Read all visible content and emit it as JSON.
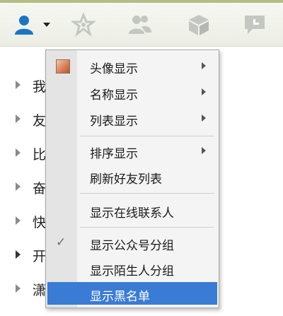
{
  "toolbar": {
    "tabs": [
      {
        "name": "contacts",
        "icon": "contacts-user-icon",
        "active": true
      },
      {
        "name": "favorites",
        "icon": "star-icon"
      },
      {
        "name": "groups",
        "icon": "group-icon"
      },
      {
        "name": "cube",
        "icon": "cube-icon"
      },
      {
        "name": "messages",
        "icon": "message-bubble-icon"
      }
    ],
    "active_color": "#1a75c2",
    "inactive_color": "#c4c7c1"
  },
  "groups": [
    {
      "label": "我",
      "count": ""
    },
    {
      "label": "友",
      "count": ""
    },
    {
      "label": "比",
      "count": ""
    },
    {
      "label": "奋",
      "count": ""
    },
    {
      "label": "快",
      "count": ""
    },
    {
      "label": "开",
      "count": ""
    },
    {
      "label": "潇",
      "count": ""
    }
  ],
  "context_menu": {
    "items": [
      {
        "label": "头像显示",
        "has_submenu": true,
        "icon": "avatar-icon"
      },
      {
        "label": "名称显示",
        "has_submenu": true
      },
      {
        "label": "列表显示",
        "has_submenu": true
      },
      {
        "label": "排序显示",
        "has_submenu": true
      },
      {
        "label": "刷新好友列表"
      },
      {
        "label": "显示在线联系人"
      },
      {
        "label": "显示公众号分组",
        "checked": true,
        "check_glyph": "✓"
      },
      {
        "label": "显示陌生人分组"
      },
      {
        "label": "显示黑名单",
        "selected": true
      }
    ],
    "highlight_color": "#3a7bd5"
  }
}
